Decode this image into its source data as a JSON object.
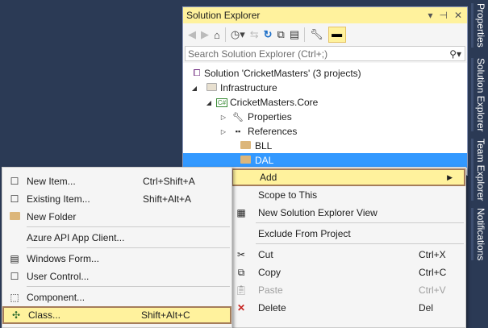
{
  "solution_explorer": {
    "title": "Solution Explorer",
    "search_placeholder": "Search Solution Explorer (Ctrl+;)",
    "tree": [
      {
        "label": "Solution 'CricketMasters' (3 projects)",
        "icon": "solution-icon"
      },
      {
        "label": "Infrastructure",
        "icon": "folder-icon"
      },
      {
        "label": "CricketMasters.Core",
        "icon": "csharp-project-icon"
      },
      {
        "label": "Properties",
        "icon": "wrench-icon"
      },
      {
        "label": "References",
        "icon": "references-icon"
      },
      {
        "label": "BLL",
        "icon": "folder-icon"
      },
      {
        "label": "DAL",
        "icon": "folder-icon",
        "selected": true
      }
    ]
  },
  "side_tabs": [
    "Properties",
    "Solution Explorer",
    "Team Explorer",
    "Notifications"
  ],
  "context_menu": [
    {
      "label": "Add",
      "shortcut": "",
      "highlighted": true
    },
    {
      "label": "Scope to This",
      "shortcut": ""
    },
    {
      "label": "New Solution Explorer View",
      "shortcut": ""
    },
    {
      "label": "Exclude From Project",
      "shortcut": ""
    },
    {
      "label": "Cut",
      "shortcut": "Ctrl+X"
    },
    {
      "label": "Copy",
      "shortcut": "Ctrl+C"
    },
    {
      "label": "Paste",
      "shortcut": "Ctrl+V",
      "disabled": true
    },
    {
      "label": "Delete",
      "shortcut": "Del"
    }
  ],
  "add_submenu": [
    {
      "label": "New Item...",
      "shortcut": "Ctrl+Shift+A"
    },
    {
      "label": "Existing Item...",
      "shortcut": "Shift+Alt+A"
    },
    {
      "label": "New Folder",
      "shortcut": ""
    },
    {
      "label": "Azure API App Client...",
      "shortcut": ""
    },
    {
      "label": "Windows Form...",
      "shortcut": ""
    },
    {
      "label": "User Control...",
      "shortcut": ""
    },
    {
      "label": "Component...",
      "shortcut": ""
    },
    {
      "label": "Class...",
      "shortcut": "Shift+Alt+C",
      "highlighted": true
    }
  ],
  "colors": {
    "selection": "#3399ff",
    "highlight": "#fff29d",
    "highlight_border": "#a57d5a",
    "background": "#2b3a55"
  }
}
